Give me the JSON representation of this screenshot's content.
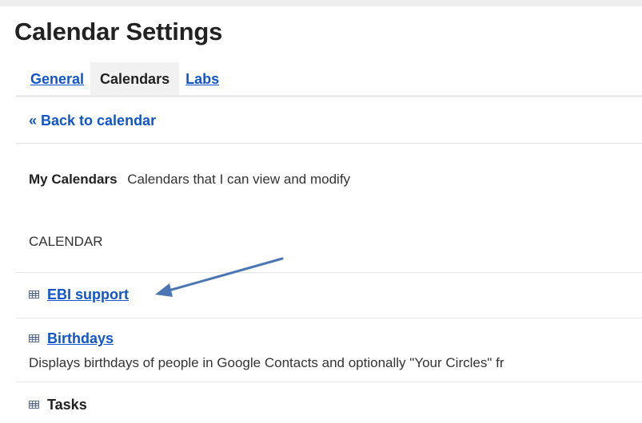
{
  "page": {
    "title": "Calendar Settings"
  },
  "tabs": [
    {
      "label": "General",
      "active": false
    },
    {
      "label": "Calendars",
      "active": true
    },
    {
      "label": "Labs",
      "active": false
    }
  ],
  "back_link": "« Back to calendar",
  "my_calendars": {
    "heading": "My Calendars",
    "description": "Calendars that I can view and modify"
  },
  "column_header": "CALENDAR",
  "calendars": [
    {
      "name": "EBI support",
      "icon": "calendar-grid-icon",
      "is_link": true,
      "description": ""
    },
    {
      "name": "Birthdays",
      "icon": "calendar-grid-icon",
      "is_link": true,
      "description": "Displays birthdays of people in Google Contacts and optionally \"Your Circles\" fr"
    },
    {
      "name": "Tasks",
      "icon": "calendar-grid-icon",
      "is_link": false,
      "description": ""
    }
  ],
  "annotation": {
    "type": "arrow",
    "color": "#4a77b4",
    "points_to": "EBI support"
  },
  "colors": {
    "link": "#1155cc",
    "text": "#222222",
    "active_tab_bg": "#f1f1f1"
  }
}
